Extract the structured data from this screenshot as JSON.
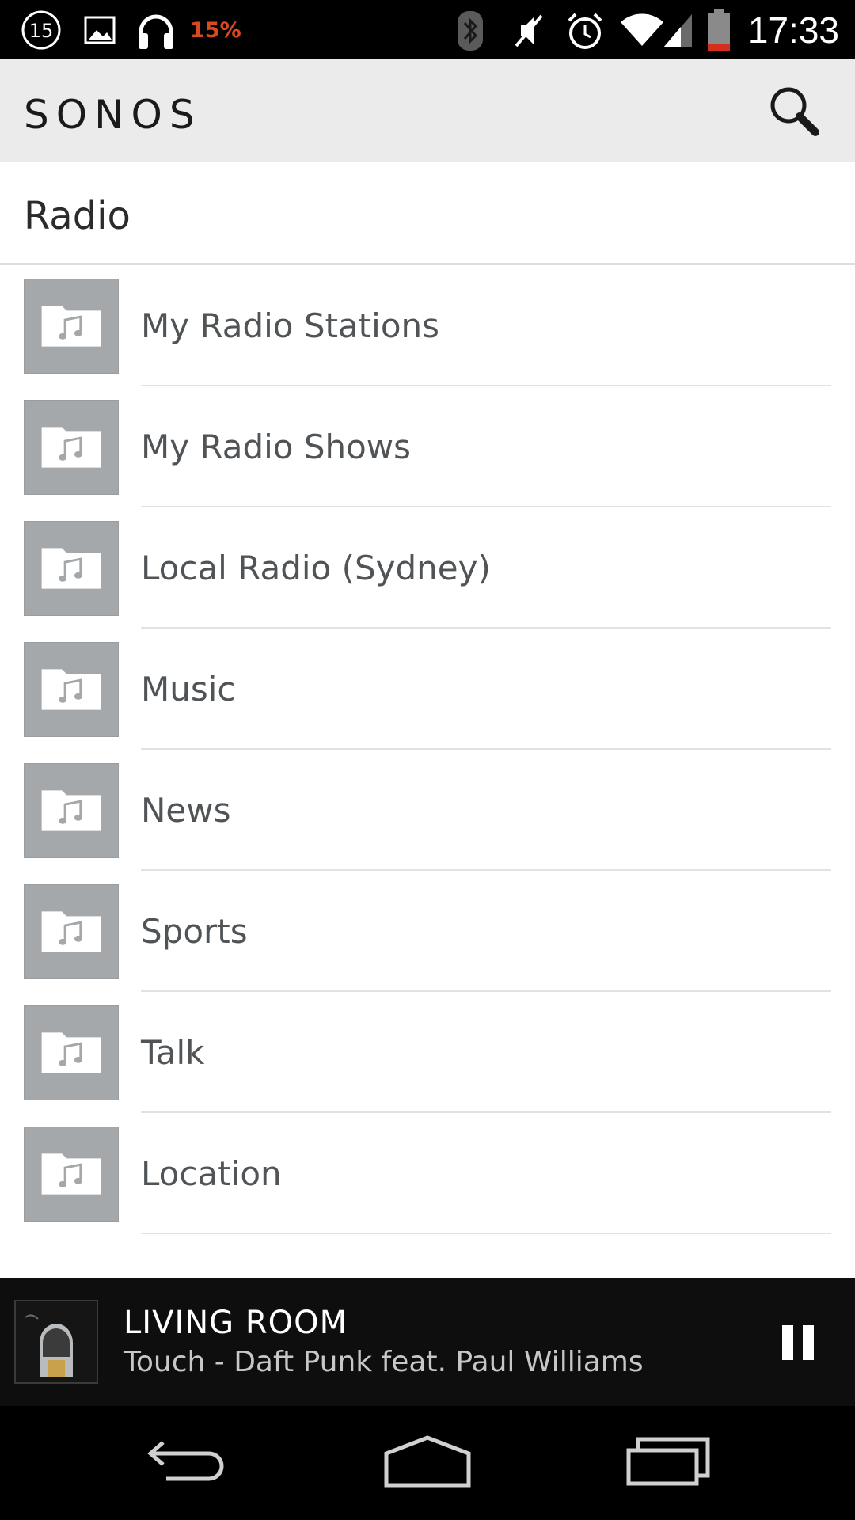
{
  "status_bar": {
    "notification_count": "15",
    "battery_percent": "15%",
    "time": "17:33"
  },
  "app_bar": {
    "brand": "SONOS",
    "search_icon": "search-icon"
  },
  "page": {
    "title": "Radio"
  },
  "list": {
    "items": [
      {
        "label": "My Radio Stations",
        "icon": "music-folder-icon"
      },
      {
        "label": "My Radio Shows",
        "icon": "music-folder-icon"
      },
      {
        "label": "Local Radio (Sydney)",
        "icon": "music-folder-icon"
      },
      {
        "label": "Music",
        "icon": "music-folder-icon"
      },
      {
        "label": "News",
        "icon": "music-folder-icon"
      },
      {
        "label": "Sports",
        "icon": "music-folder-icon"
      },
      {
        "label": "Talk",
        "icon": "music-folder-icon"
      },
      {
        "label": "Location",
        "icon": "music-folder-icon"
      }
    ]
  },
  "now_playing": {
    "room": "LIVING ROOM",
    "track": "Touch - Daft Punk feat. Paul Williams",
    "control_icon": "pause-icon"
  },
  "colors": {
    "status_bar_bg": "#000000",
    "app_bar_bg": "#ebebeb",
    "thumb_bg": "#a5a8aa",
    "now_playing_bg": "#0e0e0e",
    "battery_warning": "#d84a1f"
  }
}
